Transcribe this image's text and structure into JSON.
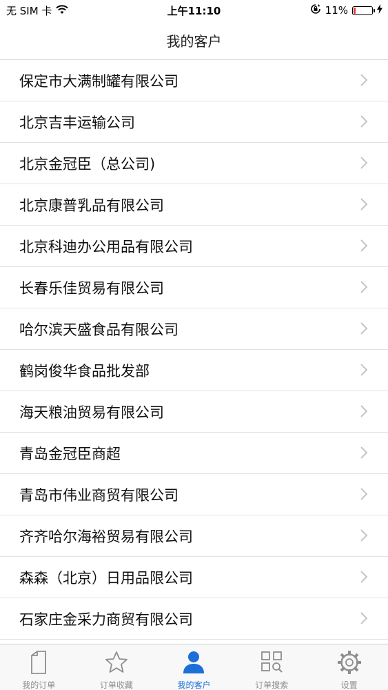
{
  "status_bar": {
    "carrier": "无 SIM 卡",
    "time": "上午11:10",
    "battery_percent": "11%",
    "battery_level": 0.11,
    "battery_color": "#e23b3b"
  },
  "nav": {
    "title": "我的客户"
  },
  "customers": [
    "保定市大满制罐有限公司",
    "北京吉丰运输公司",
    "北京金冠臣（总公司)",
    "北京康普乳品有限公司",
    "北京科迪办公用品有限公司",
    "长春乐佳贸易有限公司",
    "哈尔滨天盛食品有限公司",
    "鹤岗俊华食品批发部",
    "海天粮油贸易有限公司",
    "青岛金冠臣商超",
    "青岛市伟业商贸有限公司",
    "齐齐哈尔海裕贸易有限公司",
    "森森（北京）日用品限公司",
    "石家庄金采力商贸有限公司"
  ],
  "tabs": [
    {
      "label": "我的订单",
      "icon": "document-icon",
      "active": false
    },
    {
      "label": "订单收藏",
      "icon": "star-icon",
      "active": false
    },
    {
      "label": "我的客户",
      "icon": "person-icon",
      "active": true
    },
    {
      "label": "订单搜索",
      "icon": "search-grid-icon",
      "active": false
    },
    {
      "label": "设置",
      "icon": "gear-icon",
      "active": false
    }
  ],
  "colors": {
    "accent": "#1d6fd8",
    "inactive": "#8e8e8e"
  }
}
